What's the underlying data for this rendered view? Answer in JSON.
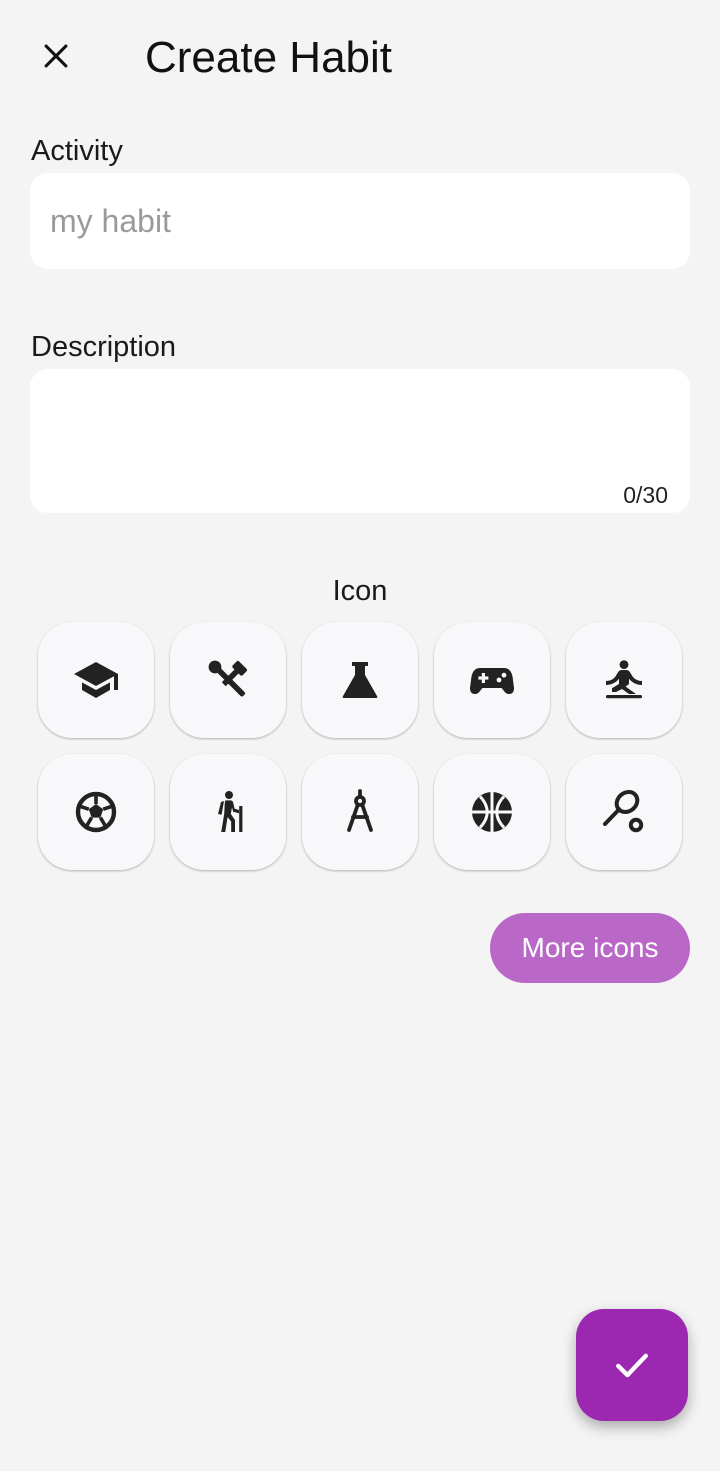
{
  "header": {
    "title": "Create Habit",
    "close_icon": "close-icon"
  },
  "activity": {
    "label": "Activity",
    "placeholder": "my habit",
    "value": ""
  },
  "description": {
    "label": "Description",
    "value": "",
    "counter": "0/30"
  },
  "icons": {
    "label": "Icon",
    "items": [
      "graduation-cap-icon",
      "tools-icon",
      "flask-icon",
      "gamepad-icon",
      "meditation-icon",
      "soccer-ball-icon",
      "hiking-icon",
      "compass-drawing-icon",
      "basketball-icon",
      "tennis-icon"
    ],
    "more_label": "More icons"
  },
  "fab": {
    "icon": "check-icon"
  },
  "colors": {
    "background": "#f4f4f4",
    "accent": "#9c27b0",
    "accent_light": "#ba68c8",
    "field_bg": "#ffffff",
    "tile_bg": "#f8f7f9"
  }
}
